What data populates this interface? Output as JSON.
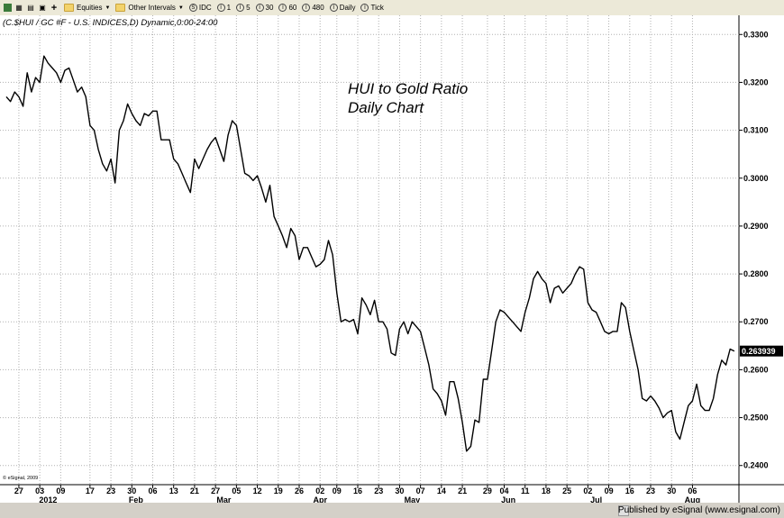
{
  "toolbar": {
    "items": [
      "Equities",
      "Other Intervals",
      "IDC",
      "1",
      "5",
      "30",
      "60",
      "480",
      "Daily",
      "Tick"
    ]
  },
  "chart_header": "(C.$HUI / GC #F - U.S. INDICES,D) Dynamic,0:00-24:00",
  "annotation": {
    "line1": "HUI to Gold Ratio",
    "line2": "Daily Chart"
  },
  "credit_small": "© eSignal, 2009",
  "footer_text": "Published by eSignal (www.esignal.com)",
  "last_value_label": "0.263939",
  "colors": {
    "line": "#000000",
    "grid": "#b0b0b0",
    "label_bg": "#000000"
  },
  "chart_data": {
    "type": "line",
    "ylim": [
      0.236,
      0.334
    ],
    "y_ticks": [
      0.24,
      0.25,
      0.26,
      0.27,
      0.28,
      0.29,
      0.3,
      0.31,
      0.32,
      0.33
    ],
    "y_tick_labels": [
      "0.2400",
      "0.2500",
      "0.2600",
      "0.2700",
      "0.2800",
      "0.2900",
      "0.3000",
      "0.3100",
      "0.3200",
      "0.3300"
    ],
    "x_tick_labels": [
      {
        "i": 3,
        "label": "27"
      },
      {
        "i": 8,
        "label": "03"
      },
      {
        "i": 13,
        "label": "09"
      },
      {
        "i": 20,
        "label": "17"
      },
      {
        "i": 25,
        "label": "23"
      },
      {
        "i": 30,
        "label": "30"
      },
      {
        "i": 35,
        "label": "06"
      },
      {
        "i": 40,
        "label": "13"
      },
      {
        "i": 45,
        "label": "21"
      },
      {
        "i": 50,
        "label": "27"
      },
      {
        "i": 55,
        "label": "05"
      },
      {
        "i": 60,
        "label": "12"
      },
      {
        "i": 65,
        "label": "19"
      },
      {
        "i": 70,
        "label": "26"
      },
      {
        "i": 75,
        "label": "02"
      },
      {
        "i": 79,
        "label": "09"
      },
      {
        "i": 84,
        "label": "16"
      },
      {
        "i": 89,
        "label": "23"
      },
      {
        "i": 94,
        "label": "30"
      },
      {
        "i": 99,
        "label": "07"
      },
      {
        "i": 104,
        "label": "14"
      },
      {
        "i": 109,
        "label": "21"
      },
      {
        "i": 115,
        "label": "29"
      },
      {
        "i": 119,
        "label": "04"
      },
      {
        "i": 124,
        "label": "11"
      },
      {
        "i": 129,
        "label": "18"
      },
      {
        "i": 134,
        "label": "25"
      },
      {
        "i": 139,
        "label": "02"
      },
      {
        "i": 144,
        "label": "09"
      },
      {
        "i": 149,
        "label": "16"
      },
      {
        "i": 154,
        "label": "23"
      },
      {
        "i": 159,
        "label": "30"
      },
      {
        "i": 164,
        "label": "06"
      }
    ],
    "x_sub_labels": [
      {
        "i": 10,
        "label": "2012"
      },
      {
        "i": 31,
        "label": "Feb"
      },
      {
        "i": 52,
        "label": "Mar"
      },
      {
        "i": 75,
        "label": "Apr"
      },
      {
        "i": 97,
        "label": "May"
      },
      {
        "i": 120,
        "label": "Jun"
      },
      {
        "i": 141,
        "label": "Jul"
      },
      {
        "i": 164,
        "label": "Aug"
      }
    ],
    "n_points": 169,
    "values": [
      0.317,
      0.316,
      0.318,
      0.317,
      0.315,
      0.322,
      0.318,
      0.321,
      0.32,
      0.3255,
      0.324,
      0.323,
      0.322,
      0.32,
      0.3225,
      0.323,
      0.3205,
      0.318,
      0.319,
      0.317,
      0.311,
      0.31,
      0.306,
      0.303,
      0.3015,
      0.304,
      0.299,
      0.31,
      0.312,
      0.3155,
      0.3135,
      0.312,
      0.311,
      0.3135,
      0.313,
      0.314,
      0.314,
      0.308,
      0.308,
      0.308,
      0.304,
      0.303,
      0.301,
      0.299,
      0.297,
      0.304,
      0.302,
      0.304,
      0.306,
      0.3075,
      0.3085,
      0.306,
      0.3035,
      0.309,
      0.312,
      0.311,
      0.306,
      0.301,
      0.3005,
      0.2995,
      0.3005,
      0.298,
      0.295,
      0.2985,
      0.292,
      0.29,
      0.288,
      0.2855,
      0.2895,
      0.288,
      0.283,
      0.2855,
      0.2855,
      0.2835,
      0.2815,
      0.282,
      0.283,
      0.287,
      0.284,
      0.276,
      0.27,
      0.2705,
      0.27,
      0.2705,
      0.2675,
      0.275,
      0.2735,
      0.2715,
      0.2745,
      0.27,
      0.27,
      0.2685,
      0.2635,
      0.263,
      0.2685,
      0.27,
      0.2675,
      0.27,
      0.269,
      0.268,
      0.2645,
      0.261,
      0.256,
      0.255,
      0.2535,
      0.2505,
      0.2575,
      0.2575,
      0.254,
      0.249,
      0.243,
      0.244,
      0.2495,
      0.249,
      0.258,
      0.258,
      0.264,
      0.27,
      0.2725,
      0.272,
      0.271,
      0.27,
      0.269,
      0.268,
      0.272,
      0.275,
      0.279,
      0.2805,
      0.279,
      0.278,
      0.274,
      0.277,
      0.2775,
      0.276,
      0.277,
      0.278,
      0.28,
      0.2815,
      0.281,
      0.274,
      0.2725,
      0.272,
      0.27,
      0.268,
      0.2675,
      0.268,
      0.268,
      0.274,
      0.273,
      0.268,
      0.264,
      0.26,
      0.254,
      0.2535,
      0.2545,
      0.2535,
      0.252,
      0.25,
      0.251,
      0.2515,
      0.247,
      0.2455,
      0.249,
      0.2525,
      0.2535,
      0.257,
      0.2525,
      0.2515,
      0.2515,
      0.254,
      0.259,
      0.262,
      0.261,
      0.2643,
      0.2639
    ]
  }
}
